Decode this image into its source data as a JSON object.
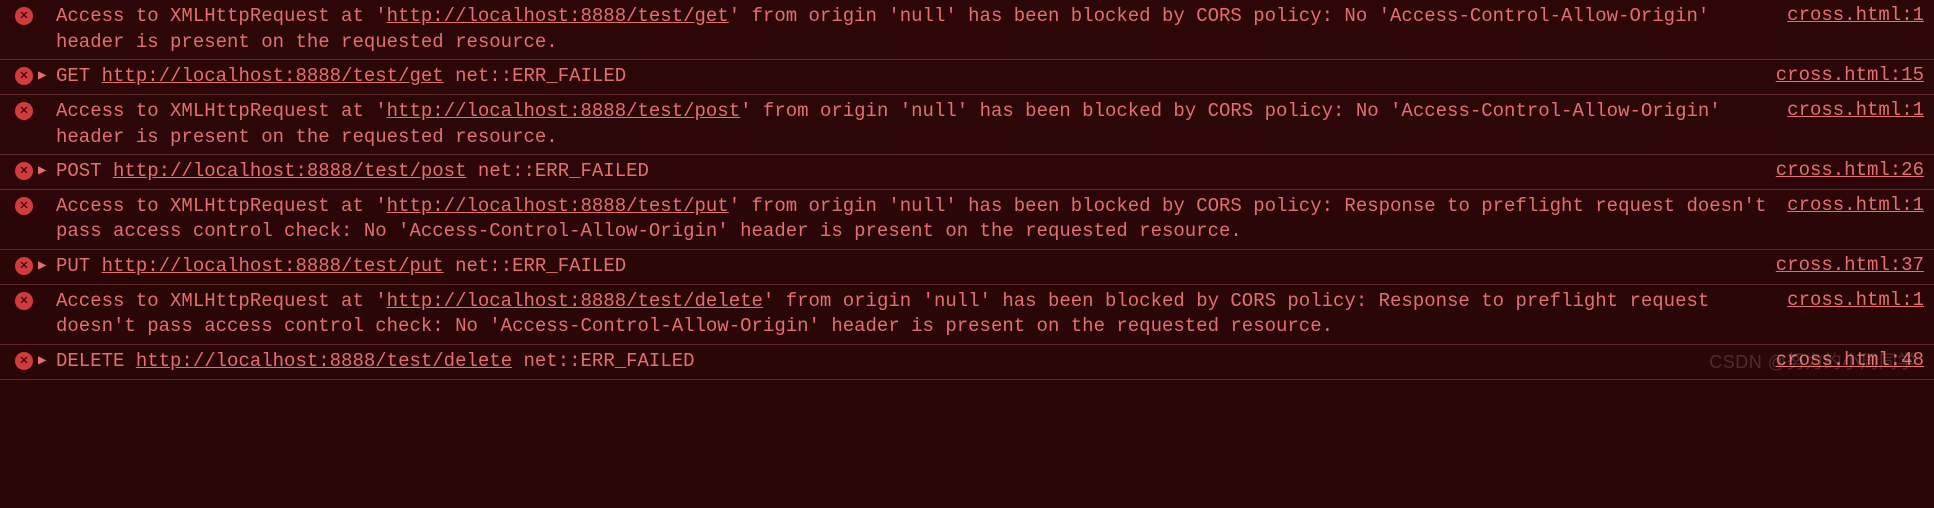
{
  "icons": {
    "error_glyph": "✕",
    "triangle_glyph": "▶"
  },
  "entries": [
    {
      "type": "cors",
      "pre": "Access to XMLHttpRequest at '",
      "url": "http://localhost:8888/test/get",
      "post": "' from origin 'null' has been blocked by CORS policy: No 'Access-Control-Allow-Origin' header is present on the requested resource.",
      "source": "cross.html:1"
    },
    {
      "type": "net",
      "method": "GET",
      "url": "http://localhost:8888/test/get",
      "status": "net::ERR_FAILED",
      "source": "cross.html:15"
    },
    {
      "type": "cors",
      "pre": "Access to XMLHttpRequest at '",
      "url": "http://localhost:8888/test/post",
      "post": "' from origin 'null' has been blocked by CORS policy: No 'Access-Control-Allow-Origin' header is present on the requested resource.",
      "source": "cross.html:1"
    },
    {
      "type": "net",
      "method": "POST",
      "url": "http://localhost:8888/test/post",
      "status": "net::ERR_FAILED",
      "source": "cross.html:26"
    },
    {
      "type": "cors",
      "pre": "Access to XMLHttpRequest at '",
      "url": "http://localhost:8888/test/put",
      "post": "' from origin 'null' has been blocked by CORS policy: Response to preflight request doesn't pass access control check: No 'Access-Control-Allow-Origin' header is present on the requested resource.",
      "source": "cross.html:1"
    },
    {
      "type": "net",
      "method": "PUT",
      "url": "http://localhost:8888/test/put",
      "status": "net::ERR_FAILED",
      "source": "cross.html:37"
    },
    {
      "type": "cors",
      "pre": "Access to XMLHttpRequest at '",
      "url": "http://localhost:8888/test/delete",
      "post": "' from origin 'null' has been blocked by CORS policy: Response to preflight request doesn't pass access control check: No 'Access-Control-Allow-Origin' header is present on the requested resource.",
      "source": "cross.html:1"
    },
    {
      "type": "net",
      "method": "DELETE",
      "url": "http://localhost:8888/test/delete",
      "status": "net::ERR_FAILED",
      "source": "cross.html:48"
    }
  ],
  "watermark": "CSDN @努力的小周同学"
}
